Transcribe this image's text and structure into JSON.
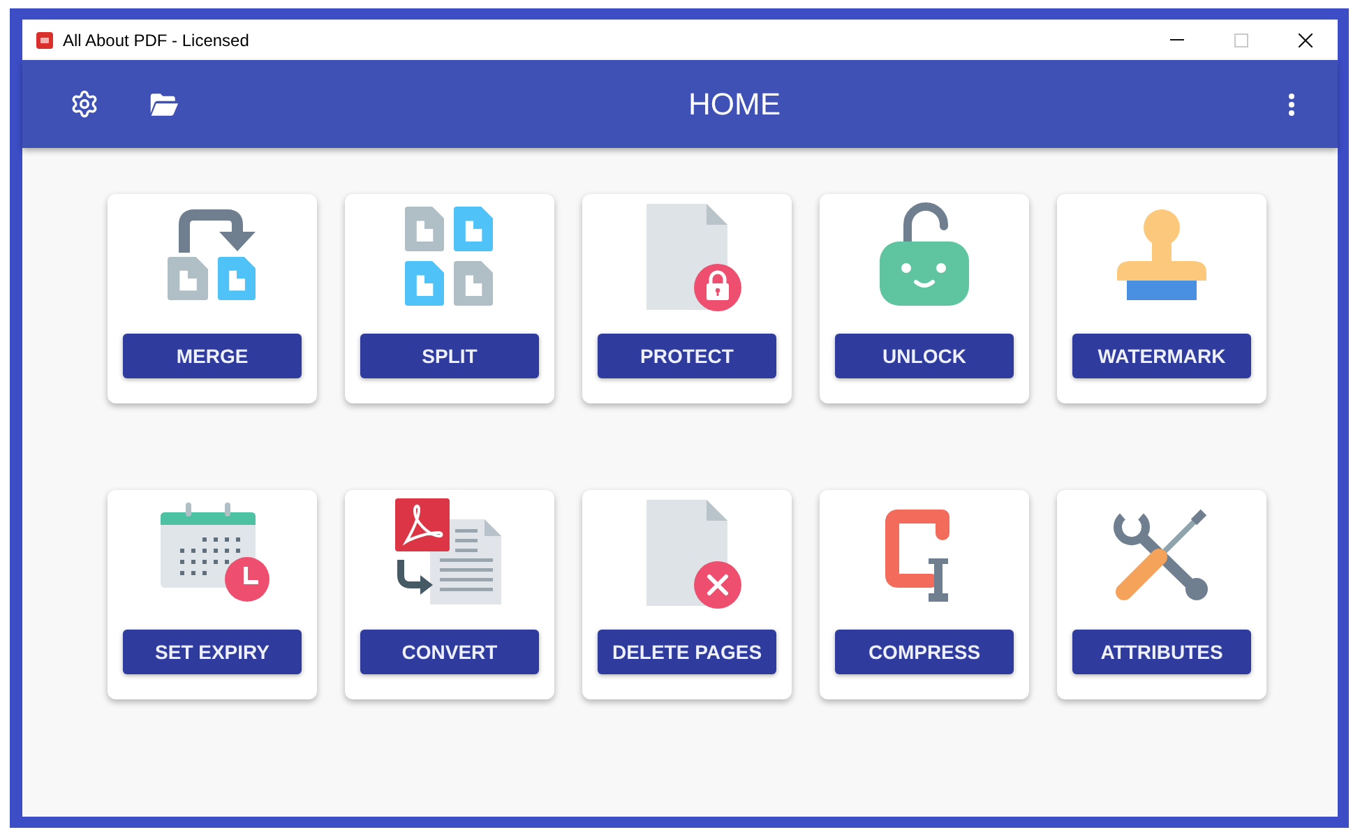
{
  "window": {
    "title": "All About PDF - Licensed",
    "controls": [
      {
        "kind": "minimize",
        "disabled": false
      },
      {
        "kind": "maximize",
        "disabled": true
      },
      {
        "kind": "close",
        "disabled": false
      }
    ]
  },
  "app_bar": {
    "title": "HOME"
  },
  "tools": [
    {
      "kind": "merge",
      "label": "MERGE"
    },
    {
      "kind": "split",
      "label": "SPLIT"
    },
    {
      "kind": "protect",
      "label": "PROTECT"
    },
    {
      "kind": "unlock",
      "label": "UNLOCK"
    },
    {
      "kind": "watermark",
      "label": "WATERMARK"
    },
    {
      "kind": "set_expiry",
      "label": "SET EXPIRY"
    },
    {
      "kind": "convert",
      "label": "CONVERT"
    },
    {
      "kind": "delete_pages",
      "label": "DELETE PAGES"
    },
    {
      "kind": "compress",
      "label": "COMPRESS"
    },
    {
      "kind": "attributes",
      "label": "ATTRIBUTES"
    }
  ]
}
